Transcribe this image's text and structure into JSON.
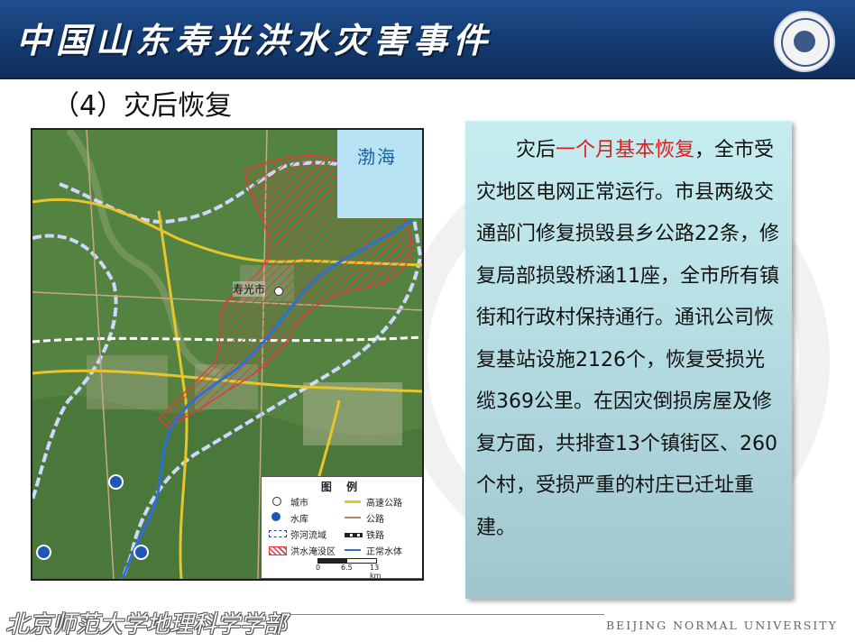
{
  "header": {
    "title": "中国山东寿光洪水灾害事件"
  },
  "subtitle": "（4）灾后恢复",
  "map": {
    "sea_label": "渤海",
    "city_label": "寿光市",
    "legend": {
      "title": "图 例",
      "items": {
        "city": "城市",
        "reservoir": "水库",
        "basin": "弥河流域",
        "flood": "洪水淹没区",
        "highway": "高速公路",
        "road": "公路",
        "railway": "铁路",
        "water": "正常水体"
      },
      "scale": {
        "s0": "0",
        "s1": "6.5",
        "s2": "13 km"
      }
    },
    "colors": {
      "flood": "#e23b3b",
      "highway": "#e8c52a",
      "river": "#2d6fd6"
    }
  },
  "panel": {
    "pre": "灾后",
    "highlight": "一个月基本恢复",
    "body": "，全市受灾地区电网正常运行。市县两级交通部门修复损毁县乡公路22条，修复局部损毁桥涵11座，全市所有镇街和行政村保持通行。通讯公司恢复基站设施2126个，恢复受损光缆369公里。在因灾倒损房屋及修复方面，共排查13个镇街区、260个村，受损严重的村庄已迁址重建。"
  },
  "footer": {
    "left": "北京师范大学地理科学学部",
    "right": "BEIJING NORMAL UNIVERSITY"
  }
}
